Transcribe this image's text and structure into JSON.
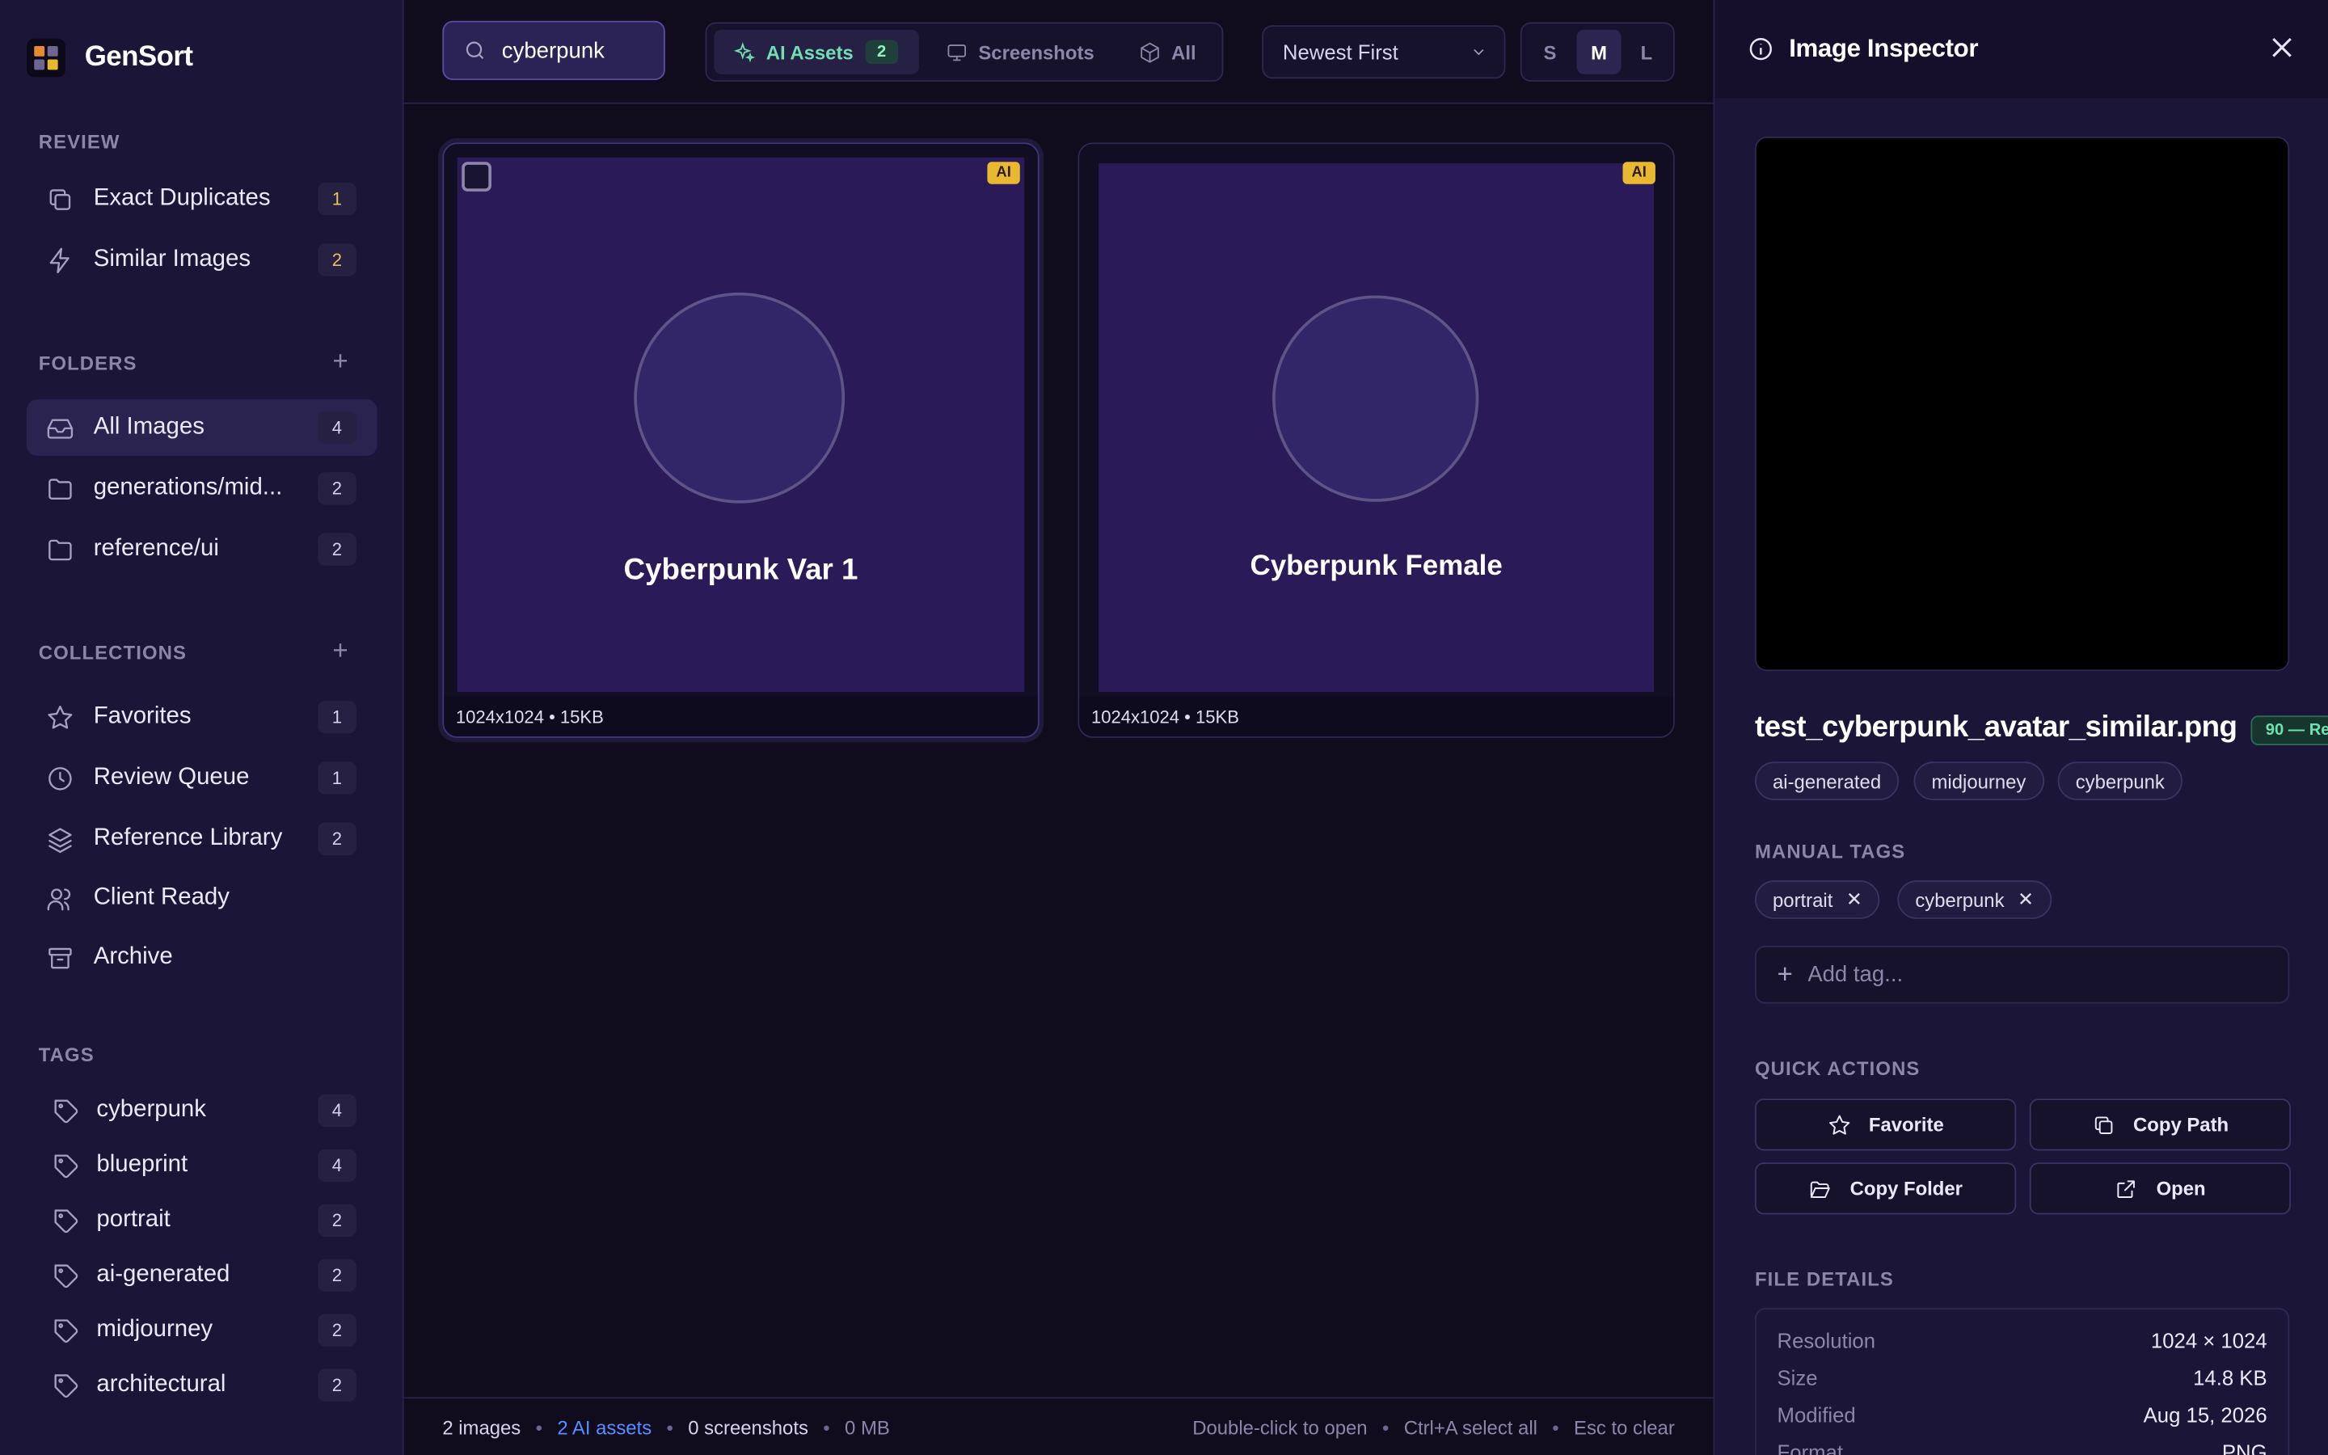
{
  "app": {
    "name": "GenSort"
  },
  "sidebar": {
    "review": {
      "title": "REVIEW",
      "items": [
        {
          "label": "Exact Duplicates",
          "count": "1",
          "icon": "copy-icon"
        },
        {
          "label": "Similar Images",
          "count": "2",
          "icon": "zap-icon"
        }
      ]
    },
    "folders": {
      "title": "FOLDERS",
      "add_label": "+",
      "items": [
        {
          "label": "All Images",
          "count": "4",
          "icon": "inbox-icon",
          "active": true
        },
        {
          "label": "generations/mid...",
          "count": "2",
          "icon": "folder-icon"
        },
        {
          "label": "reference/ui",
          "count": "2",
          "icon": "folder-icon"
        }
      ]
    },
    "collections": {
      "title": "COLLECTIONS",
      "add_label": "+",
      "items": [
        {
          "label": "Favorites",
          "count": "1",
          "icon": "star-icon"
        },
        {
          "label": "Review Queue",
          "count": "1",
          "icon": "clock-icon"
        },
        {
          "label": "Reference Library",
          "count": "2",
          "icon": "layers-icon"
        },
        {
          "label": "Client Ready",
          "count": "",
          "icon": "users-icon"
        },
        {
          "label": "Archive",
          "count": "",
          "icon": "archive-icon"
        }
      ]
    },
    "tags": {
      "title": "TAGS",
      "items": [
        {
          "label": "cyberpunk",
          "count": "4"
        },
        {
          "label": "blueprint",
          "count": "4"
        },
        {
          "label": "portrait",
          "count": "2"
        },
        {
          "label": "ai-generated",
          "count": "2"
        },
        {
          "label": "midjourney",
          "count": "2"
        },
        {
          "label": "architectural",
          "count": "2"
        }
      ]
    }
  },
  "toolbar": {
    "search_value": "cyberpunk",
    "filters": [
      {
        "label": "AI Assets",
        "badge": "2",
        "icon": "sparkles-icon",
        "active": true
      },
      {
        "label": "Screenshots",
        "icon": "monitor-icon"
      },
      {
        "label": "All",
        "icon": "box-icon"
      }
    ],
    "sort": "Newest First",
    "sizes": [
      "S",
      "M",
      "L"
    ],
    "active_size": "M"
  },
  "grid": {
    "cards": [
      {
        "title": "Cyberpunk Var 1",
        "meta": "1024x1024 • 15KB",
        "badge": "AI",
        "selected": true
      },
      {
        "title": "Cyberpunk Female",
        "meta": "1024x1024 • 15KB",
        "badge": "AI",
        "selected": false
      }
    ]
  },
  "status": {
    "images": "2 images",
    "ai_assets": "2 AI assets",
    "screenshots": "0 screenshots",
    "size": "0 MB",
    "separator": "•",
    "hints": [
      "Double-click to open",
      "Ctrl+A select all",
      "Esc to clear"
    ]
  },
  "inspector": {
    "title": "Image Inspector",
    "filename": "test_cyberpunk_avatar_similar.png",
    "score": "90 — Re",
    "auto_tags": [
      "ai-generated",
      "midjourney",
      "cyberpunk"
    ],
    "manual_tags_title": "MANUAL TAGS",
    "manual_tags": [
      "portrait",
      "cyberpunk"
    ],
    "add_tag_placeholder": "Add tag...",
    "quick_actions_title": "QUICK ACTIONS",
    "quick_actions": [
      {
        "label": "Favorite",
        "icon": "star-icon"
      },
      {
        "label": "Copy Path",
        "icon": "copy-icon"
      },
      {
        "label": "Copy Folder",
        "icon": "folder-open-icon"
      },
      {
        "label": "Open",
        "icon": "external-link-icon"
      }
    ],
    "file_details_title": "FILE DETAILS",
    "file_details": [
      {
        "key": "Resolution",
        "value": "1024 × 1024"
      },
      {
        "key": "Size",
        "value": "14.8 KB"
      },
      {
        "key": "Modified",
        "value": "Aug 15, 2026"
      },
      {
        "key": "Format",
        "value": "PNG"
      }
    ]
  },
  "colors": {
    "accent_green": "#6fe0b0",
    "badge_amber": "#e8b830",
    "link_blue": "#5a8dff",
    "sidebar_bg": "#1b1537",
    "main_bg": "#100c1e"
  }
}
